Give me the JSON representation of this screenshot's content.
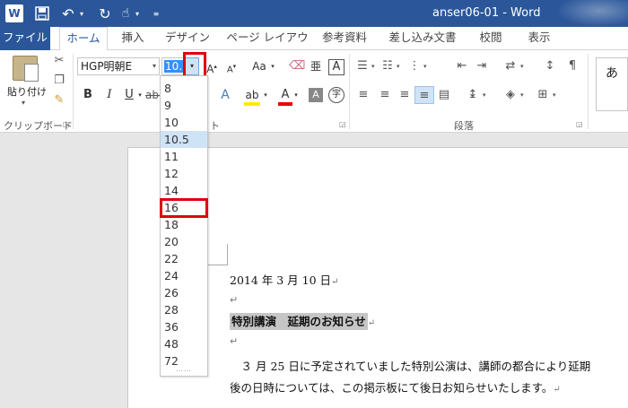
{
  "titlebar": {
    "app_icon": "W",
    "doc_title": "anser06-01 - Word",
    "icons": {
      "save": "save-icon",
      "undo": "undo-icon",
      "redo": "redo-icon",
      "touch": "touch-mode-icon"
    }
  },
  "tabs": {
    "file": "ファイル",
    "home": "ホーム",
    "insert": "挿入",
    "design": "デザイン",
    "layout": "ページ レイアウト",
    "references": "参考資料",
    "mailings": "差し込み文書",
    "review": "校閲",
    "view": "表示"
  },
  "ribbon": {
    "clipboard": {
      "paste_label": "貼り付け",
      "group_label": "クリップボード"
    },
    "font": {
      "name": "HGP明朝E",
      "size": "10.5",
      "group_label_tail": "ト",
      "bold": "B",
      "italic": "I",
      "underline": "U",
      "grow": "A",
      "shrink": "A",
      "case": "Aa",
      "char_border": "A",
      "shade": "A",
      "enclose": "字"
    },
    "paragraph": {
      "group_label": "段落"
    },
    "styles": {
      "preview": "あ"
    },
    "colors": {
      "highlight": "#ffeb00",
      "font_color": "#e00000",
      "accent": "#2b579a"
    }
  },
  "font_size_list": [
    "8",
    "9",
    "10",
    "10.5",
    "11",
    "12",
    "14",
    "16",
    "18",
    "20",
    "22",
    "24",
    "26",
    "28",
    "36",
    "48",
    "72"
  ],
  "font_size_current": "10.5",
  "document": {
    "date_line": "2014 年 3 月 10 日",
    "heading": "特別講演　延期のお知らせ",
    "body_line1": "　３ 月 25 日に予定されていました特別公演は、講師の都合により延期",
    "body_line2": "後の日時については、この掲示板にて後日お知らせいたします。",
    "para_mark": "↵"
  }
}
